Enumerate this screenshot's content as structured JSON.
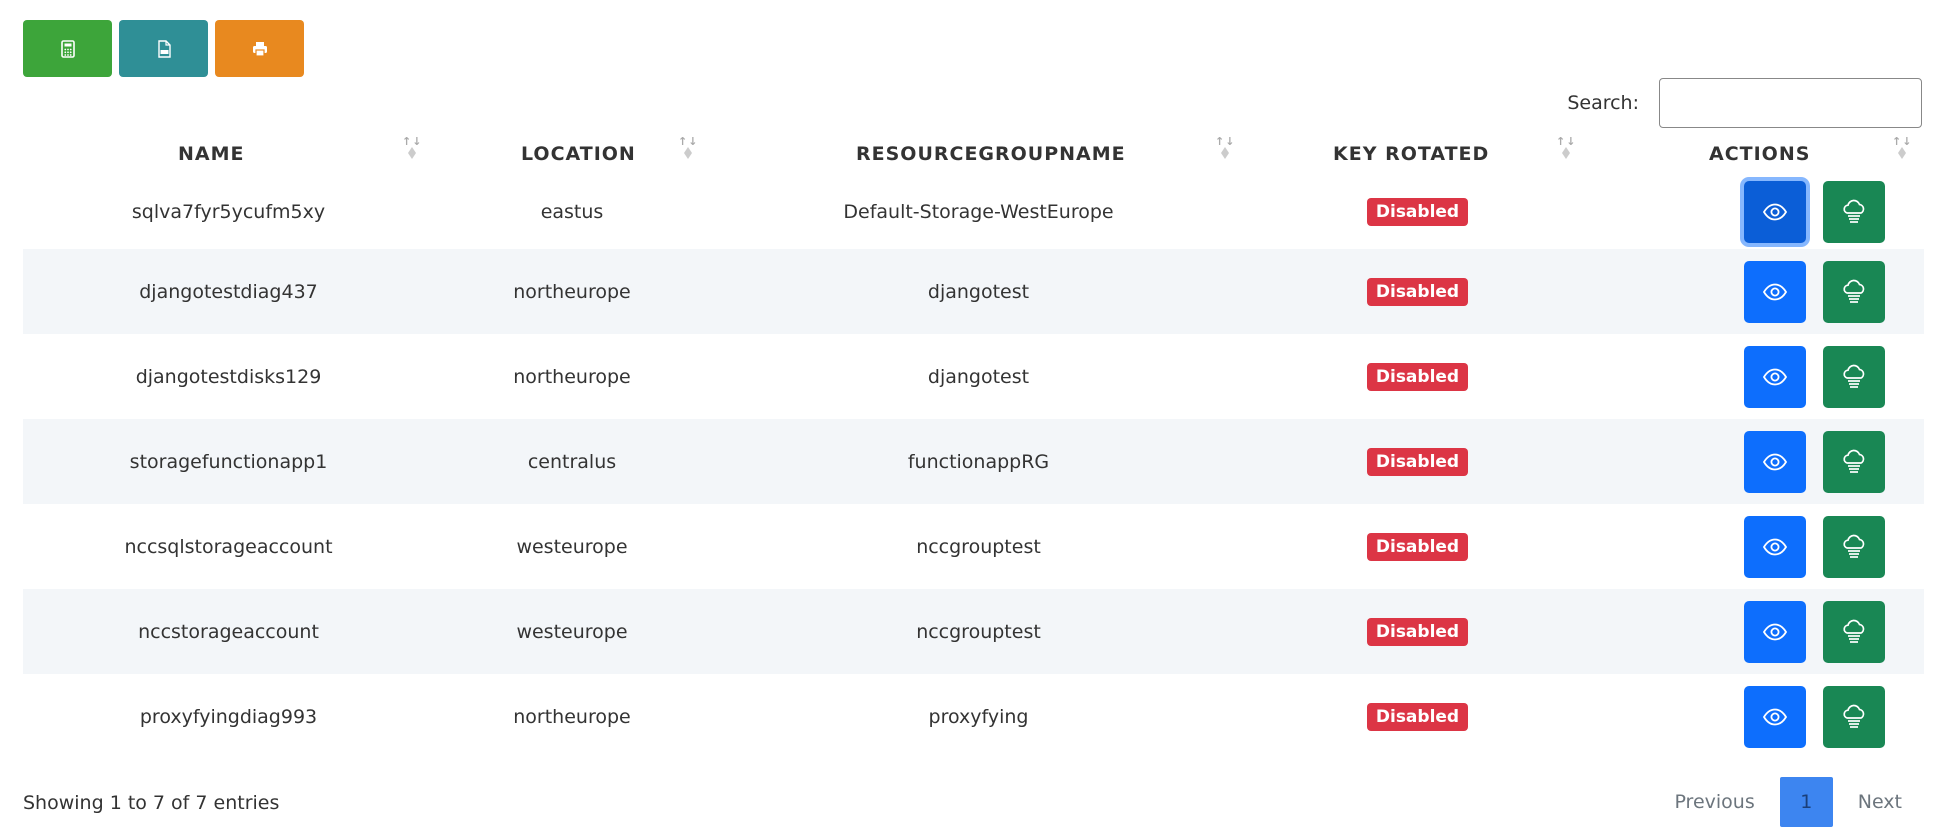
{
  "toolbar": {
    "buttons": [
      {
        "icon": "calculator-icon",
        "color": "#3da53a"
      },
      {
        "icon": "csv-file-icon",
        "color": "#2f8f96"
      },
      {
        "icon": "print-icon",
        "color": "#e8891f"
      }
    ]
  },
  "search": {
    "label": "Search:",
    "value": "",
    "placeholder": ""
  },
  "table": {
    "headers": [
      "NAME",
      "LOCATION",
      "RESOURCEGROUPNAME",
      "KEY ROTATED",
      "ACTIONS"
    ],
    "rows": [
      {
        "name": "sqlva7fyr5ycufm5xy",
        "location": "eastus",
        "rg": "Default-Storage-WestEurope",
        "key": "Disabled"
      },
      {
        "name": "djangotestdiag437",
        "location": "northeurope",
        "rg": "djangotest",
        "key": "Disabled"
      },
      {
        "name": "djangotestdisks129",
        "location": "northeurope",
        "rg": "djangotest",
        "key": "Disabled"
      },
      {
        "name": "storagefunctionapp1",
        "location": "centralus",
        "rg": "functionappRG",
        "key": "Disabled"
      },
      {
        "name": "nccsqlstorageaccount",
        "location": "westeurope",
        "rg": "nccgrouptest",
        "key": "Disabled"
      },
      {
        "name": "nccstorageaccount",
        "location": "westeurope",
        "rg": "nccgrouptest",
        "key": "Disabled"
      },
      {
        "name": "proxyfyingdiag993",
        "location": "northeurope",
        "rg": "proxyfying",
        "key": "Disabled"
      }
    ],
    "action_icons": [
      "eye-icon",
      "cloud-rotate-icon"
    ]
  },
  "footer": {
    "info": "Showing 1 to 7 of 7 entries",
    "previous": "Previous",
    "page": "1",
    "next": "Next"
  },
  "colors": {
    "badge": "#dc3545",
    "view_button": "#0d6efd",
    "rotate_button": "#198754",
    "stripe": "#f3f6f9"
  }
}
